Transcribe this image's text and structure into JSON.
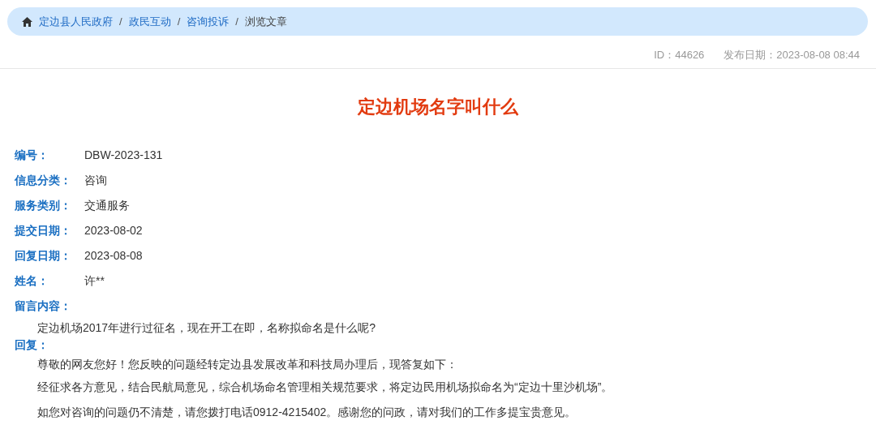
{
  "breadcrumb": [
    {
      "label": "定边县人民政府",
      "link": true
    },
    {
      "separator": "/",
      "label": "政民互动",
      "link": true
    },
    {
      "separator": "/",
      "label": "咨询投诉",
      "link": true
    },
    {
      "separator": "/",
      "label": "浏览文章",
      "link": false
    }
  ],
  "meta": {
    "id": "ID：44626",
    "published": "发布日期：2023-08-08 08:44"
  },
  "title": "定边机场名字叫什么",
  "fields": [
    {
      "label": "编号：",
      "value": "DBW-2023-131"
    },
    {
      "label": "信息分类：",
      "value": "咨询"
    },
    {
      "label": "服务类别：",
      "value": "交通服务"
    },
    {
      "label": "提交日期：",
      "value": "2023-08-02"
    },
    {
      "label": "回复日期：",
      "value": "2023-08-08"
    },
    {
      "label": "姓名：",
      "value": "许**"
    }
  ],
  "message": {
    "label": "留言内容：",
    "paragraphs": [
      "定边机场2017年进行过征名，现在开工在即，名称拟命名是什么呢?"
    ]
  },
  "reply": {
    "label": "回复：",
    "paragraphs": [
      "尊敬的网友您好！您反映的问题经转定边县发展改革和科技局办理后，现答复如下：",
      "经征求各方意见，结合民航局意见，综合机场命名管理相关规范要求，将定边民用机场拟命名为“定边十里沙机场”。",
      "如您对咨询的问题仍不清楚，请您拨打电话0912-4215402。感谢您的问政，请对我们的工作多提宝贵意见。"
    ]
  }
}
